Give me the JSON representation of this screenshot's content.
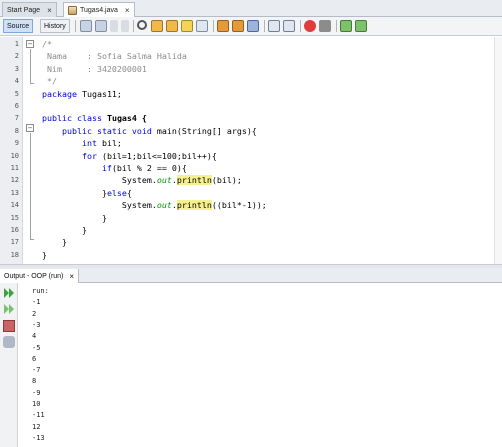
{
  "tabs": [
    {
      "label": "Start Page",
      "close": "×"
    },
    {
      "label": "Tugas4.java",
      "close": "×"
    }
  ],
  "toolbar": {
    "source_label": "Source",
    "history_label": "History"
  },
  "editor": {
    "line_numbers": [
      "1",
      "2",
      "3",
      "4",
      "5",
      "6",
      "7",
      "8",
      "9",
      "10",
      "11",
      "12",
      "13",
      "14",
      "15",
      "16",
      "17",
      "18"
    ],
    "lines": [
      [
        {
          "t": "/*",
          "c": "cm"
        }
      ],
      [
        {
          "t": " Nama    : Sofia Salma Halida",
          "c": "cm"
        }
      ],
      [
        {
          "t": " Nim     : 3420200001",
          "c": "cm"
        }
      ],
      [
        {
          "t": " */",
          "c": "cm"
        }
      ],
      [
        {
          "t": "package",
          "c": "kw"
        },
        {
          "t": " Tugas11;",
          "c": ""
        }
      ],
      [],
      [
        {
          "t": "public class",
          "c": "kw"
        },
        {
          "t": " Tugas4 {",
          "c": "bold"
        }
      ],
      [
        {
          "t": "    public static void",
          "c": "kw"
        },
        {
          "t": " main(String[] args){",
          "c": ""
        }
      ],
      [
        {
          "t": "        int",
          "c": "kw"
        },
        {
          "t": " bil;",
          "c": ""
        }
      ],
      [
        {
          "t": "        for",
          "c": "kw"
        },
        {
          "t": " (bil=1;bil<=100;bil++){",
          "c": ""
        }
      ],
      [
        {
          "t": "            if",
          "c": "kw"
        },
        {
          "t": "(bil % 2 == 0){",
          "c": ""
        }
      ],
      [
        {
          "t": "                System.",
          "c": ""
        },
        {
          "t": "out",
          "c": "fld"
        },
        {
          "t": ".",
          "c": ""
        },
        {
          "t": "println",
          "c": "hl"
        },
        {
          "t": "(bil);",
          "c": ""
        }
      ],
      [
        {
          "t": "            }",
          "c": ""
        },
        {
          "t": "else",
          "c": "kw"
        },
        {
          "t": "{",
          "c": ""
        }
      ],
      [
        {
          "t": "                System.",
          "c": ""
        },
        {
          "t": "out",
          "c": "fld"
        },
        {
          "t": ".",
          "c": ""
        },
        {
          "t": "println",
          "c": "hl"
        },
        {
          "t": "((bil*-1));",
          "c": ""
        }
      ],
      [
        {
          "t": "            }",
          "c": ""
        }
      ],
      [
        {
          "t": "        }",
          "c": ""
        }
      ],
      [
        {
          "t": "    }",
          "c": ""
        }
      ],
      [
        {
          "t": "}",
          "c": ""
        }
      ]
    ]
  },
  "output": {
    "tab_label": "Output - OOP (run)",
    "close": "×",
    "lines": [
      "run:",
      "-1",
      "2",
      "-3",
      "4",
      "-5",
      "6",
      "-7",
      "8",
      "-9",
      "10",
      "-11",
      "12",
      "-13"
    ]
  },
  "colors": {
    "keyword": "#0000e6",
    "comment": "#8c8c8c",
    "field": "#009900",
    "highlight": "#f6f18f"
  },
  "icons": [
    "java-file-icon",
    "back-icon",
    "forward-icon",
    "find-icon",
    "find-previous-icon",
    "find-next-icon",
    "toggle-highlight-icon",
    "toggle-rectangular-icon",
    "previous-bookmark-icon",
    "next-bookmark-icon",
    "toggle-bookmark-icon",
    "shift-left-icon",
    "shift-right-icon",
    "start-macro-icon",
    "stop-macro-icon",
    "comment-icon",
    "uncomment-icon",
    "rerun-icon",
    "rerun-different-icon",
    "stop-icon",
    "output-settings-icon"
  ]
}
